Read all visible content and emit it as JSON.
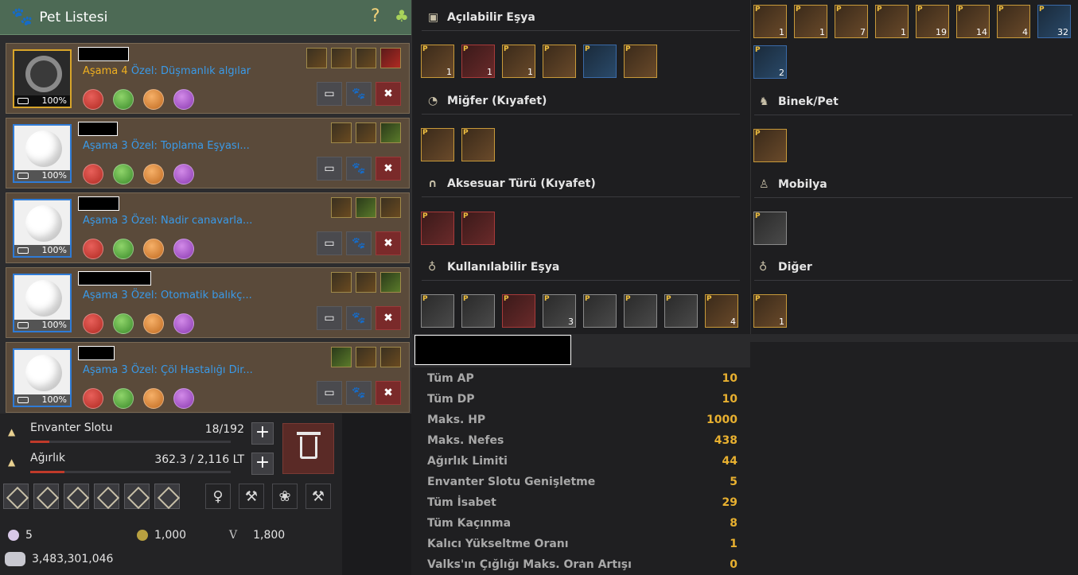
{
  "pet_window": {
    "title": "Pet Listesi",
    "help": "?",
    "pets": [
      {
        "stage_label": "Aşama",
        "stage_num": "4",
        "special": "Özel: Düşmanlık algılar",
        "hunger": "100%",
        "gold": true
      },
      {
        "stage_label": "Aşama",
        "stage_num": "3",
        "special": "Özel: Toplama Eşyası...",
        "hunger": "100%",
        "gold": false
      },
      {
        "stage_label": "Aşama",
        "stage_num": "3",
        "special": "Özel: Nadir canavarla...",
        "hunger": "100%",
        "gold": false
      },
      {
        "stage_label": "Aşama",
        "stage_num": "3",
        "special": "Özel: Otomatik balıkç...",
        "hunger": "100%",
        "gold": false
      },
      {
        "stage_label": "Aşama",
        "stage_num": "3",
        "special": "Özel: Çöl Hastalığı Dir...",
        "hunger": "100%",
        "gold": false
      }
    ]
  },
  "inventory": {
    "slots_label": "Envanter Slotu",
    "slots_value": "18/192",
    "slots_fill": 0.094,
    "weight_label": "Ağırlık",
    "weight_value": "362.3 / 2,116 LT",
    "weight_fill": 0.171,
    "currencies": {
      "pearls": "5",
      "coins": "1,000",
      "v_label": "V",
      "valks": "1,800",
      "silver": "3,483,301,046"
    }
  },
  "items": {
    "categories": {
      "openable": "Açılabilir Eşya",
      "helmet": "Miğfer (Kıyafet)",
      "accessory": "Aksesuar Türü (Kıyafet)",
      "usable": "Kullanılabilir Eşya",
      "mount": "Binek/Pet",
      "furniture": "Mobilya",
      "other": "Diğer"
    },
    "counts": {
      "openable_1": "1",
      "openable_2": "1",
      "openable_3": "1",
      "top_1": "1",
      "top_2": "1",
      "top_3": "7",
      "top_4": "1",
      "top_5": "19",
      "top_6": "14",
      "top_7": "4",
      "top_8": "32",
      "top_9": "2",
      "usable_4": "3",
      "usable_8": "4",
      "other_1": "1"
    }
  },
  "stats": [
    {
      "name": "Tüm AP",
      "value": "10"
    },
    {
      "name": "Tüm DP",
      "value": "10"
    },
    {
      "name": "Maks. HP",
      "value": "1000"
    },
    {
      "name": "Maks. Nefes",
      "value": "438"
    },
    {
      "name": "Ağırlık Limiti",
      "value": "44"
    },
    {
      "name": "Envanter Slotu Genişletme",
      "value": "5"
    },
    {
      "name": "Tüm İsabet",
      "value": "29"
    },
    {
      "name": "Tüm Kaçınma",
      "value": "8"
    },
    {
      "name": "Kalıcı Yükseltme Oranı",
      "value": "1"
    },
    {
      "name": "Valks'ın Çığlığı Maks. Oran Artışı",
      "value": "0"
    }
  ]
}
